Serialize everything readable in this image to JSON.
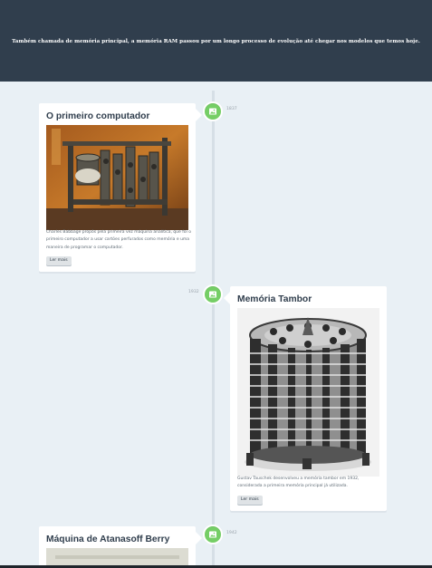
{
  "header": {
    "subtitle": "Também chamada de memória principal, a memória RAM passou por um longo processo de evolução até chegar nos modelos que temos hoje."
  },
  "colors": {
    "header_bg": "#303e4d",
    "page_bg": "#e9f0f5",
    "marker": "#75ce66"
  },
  "timeline": [
    {
      "date": "1837",
      "icon": "image-icon",
      "title": "O primeiro computador",
      "image_alt": "Máquina analítica de Charles Babbage",
      "description": "Charles Babbage propôs pela primeira vez máquina analítica, que foi o primeiro computador a usar cartões perfurados como memória e uma maneira de programar o computador.",
      "button": "Ler mais"
    },
    {
      "date": "1932",
      "icon": "image-icon",
      "title": "Memória Tambor",
      "image_alt": "Memória tambor",
      "description": "Gustav Tauschek desenvolveu a memória tambor em 1932, considerada a primeira memória principal já utilizada.",
      "button": "Ler mais"
    },
    {
      "date": "1942",
      "icon": "image-icon",
      "title": "Máquina de Atanasoff Berry"
    }
  ]
}
